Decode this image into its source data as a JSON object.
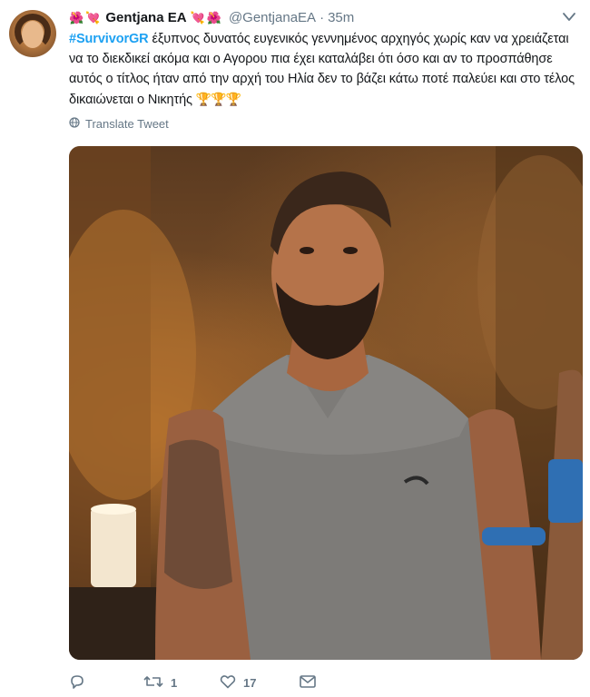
{
  "tweet": {
    "display_name": "Gentjana EA",
    "handle": "@GentjanaEA",
    "separator": "·",
    "time": "35m",
    "hashtag": "#SurvivorGR",
    "text": " έξυπνος δυνατός ευγενικός γεννημένος αρχηγός χωρίς καν να χρειάζεται να το διεκδικεί ακόμα και ο Αγορου πια έχει καταλάβει ότι όσο και αν το προσπάθησε αυτός ο τίτλος ήταν από την αρχή του Ηλία δεν το βάζει κάτω ποτέ παλεύει και στο τέλος δικαιώνεται ο Νικητής ",
    "trophies": "🏆🏆🏆",
    "name_emojis_left": [
      "🌺",
      "💘"
    ],
    "name_emojis_right": [
      "💘",
      "🌺"
    ],
    "translate_label": "Translate Tweet"
  },
  "actions": {
    "reply_icon": "reply-icon",
    "retweet_icon": "retweet-icon",
    "retweet_count": "1",
    "like_icon": "heart-icon",
    "like_count": "17",
    "dm_icon": "envelope-icon"
  },
  "colors": {
    "link": "#1da1f2",
    "secondary_text": "#657786",
    "primary_text": "#14171a"
  }
}
